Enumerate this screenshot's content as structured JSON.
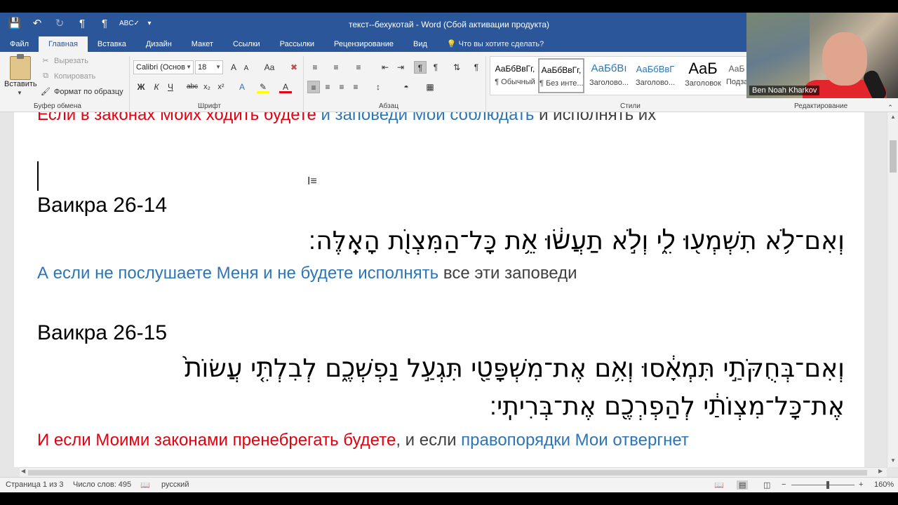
{
  "window": {
    "title": "текст--бехукотай - Word (Сбой активации продукта)"
  },
  "qat": {
    "save_icon": "save-icon",
    "undo_icon": "undo-icon",
    "redo_icon": "redo-icon",
    "pilcrow_icon": "pilcrow-icon",
    "spelling_icon": "abc-check-icon"
  },
  "tabs": [
    {
      "label": "Файл"
    },
    {
      "label": "Главная"
    },
    {
      "label": "Вставка"
    },
    {
      "label": "Дизайн"
    },
    {
      "label": "Макет"
    },
    {
      "label": "Ссылки"
    },
    {
      "label": "Рассылки"
    },
    {
      "label": "Рецензирование"
    },
    {
      "label": "Вид"
    },
    {
      "label": "Что вы хотите сделать?"
    }
  ],
  "clipboard": {
    "paste_label": "Вставить",
    "cut_label": "Вырезать",
    "copy_label": "Копировать",
    "format_painter_label": "Формат по образцу",
    "group_label": "Буфер обмена"
  },
  "font": {
    "name": "Calibri (Основ",
    "size": "18",
    "bold": "Ж",
    "italic": "К",
    "underline": "Ч",
    "strike": "abc",
    "subscript": "x₂",
    "superscript": "x²",
    "grow": "A",
    "shrink": "A",
    "case": "Aa",
    "group_label": "Шрифт"
  },
  "paragraph": {
    "group_label": "Абзац",
    "pilcrow": "¶"
  },
  "styles": {
    "group_label": "Стили",
    "items": [
      {
        "sample": "АаБбВвГг,",
        "name": "¶ Обычный"
      },
      {
        "sample": "АаБбВвГг,",
        "name": "¶ Без инте..."
      },
      {
        "sample": "АаБбВı",
        "name": "Заголово..."
      },
      {
        "sample": "АаБбВвГ",
        "name": "Заголово..."
      },
      {
        "sample": "AaБ",
        "name": "Заголовок"
      },
      {
        "sample": "АаБ",
        "name": "Подза"
      }
    ]
  },
  "editing": {
    "group_label": "Редактирование"
  },
  "webcam": {
    "name": "Ben Noah Kharkov"
  },
  "document": {
    "top_line": {
      "red": "Если в законах Моих ходить будете",
      "blue": " и заповеди Мои соблюдать",
      "dark": " и исполнять их"
    },
    "heading1": "Ваикра 26-14",
    "hebrew1": "וְאִם־לֹ֥א תִשְׁמְע֖וּ לִ֑י וְלֹ֣א תַעֲשׂ֔וּ אֵ֥ת כָּל־הַמִּצְוֺ֖ת הָאֵֽלֶּה׃",
    "ru1": {
      "blue": "А если не послушаете Меня и не будете исполнять",
      "dark": " все эти заповеди"
    },
    "heading2": "Ваикра 26-15",
    "hebrew2a": "וְאִם־בְּחֻקֹּתַ֣י תִּמְאָ֔סוּ וְאִ֥ם אֶת־מִשְׁפָּטַ֖י תִּגְעַ֣ל נַפְשְׁכֶ֑ם לְבִלְתִּ֤י עֲשׂוֹת֙",
    "hebrew2b": "אֶת־כָּל־מִצְוֺתַ֔י לְהַפְרְכֶ֖ם אֶת־בְּרִיתִֽי׃",
    "ru2": {
      "red": "И если Моими законами пренебрегать будете",
      "dark": ", и если ",
      "blue": "правопорядки Мои отвергнет"
    }
  },
  "status": {
    "page": "Страница 1 из 3",
    "words": "Число слов: 495",
    "language": "русский",
    "zoom": "160%"
  }
}
